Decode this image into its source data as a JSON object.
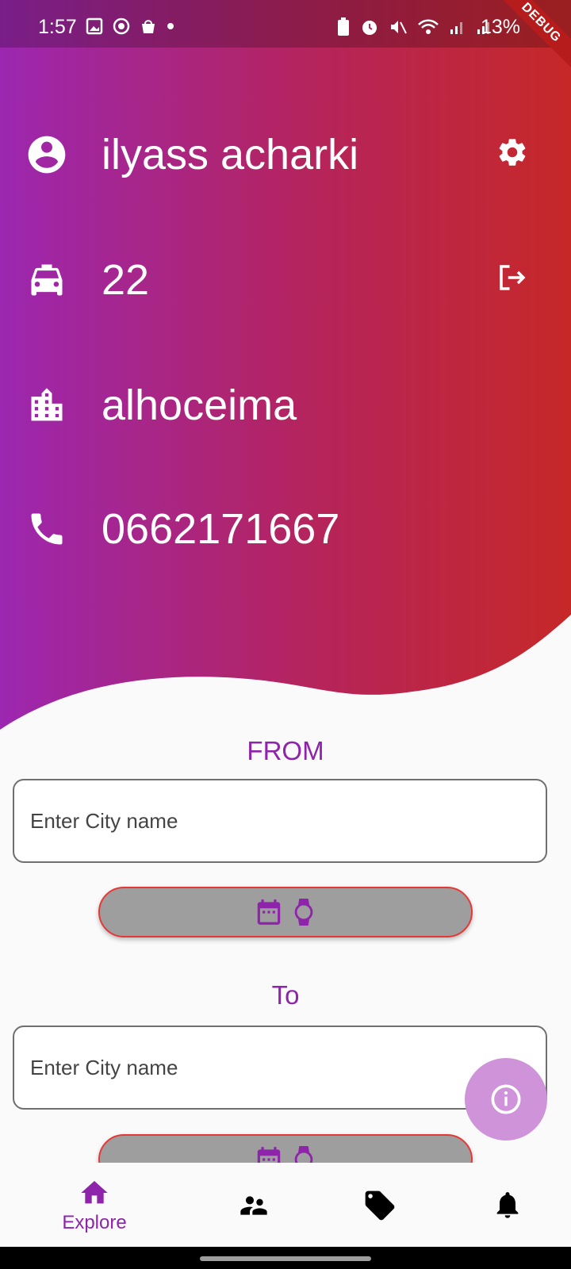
{
  "status_bar": {
    "time": "1:57",
    "battery": "13%",
    "debug_banner": "DEBUG"
  },
  "profile": {
    "name": "ilyass acharki",
    "taxi_number": "22",
    "city": "alhoceima",
    "phone": "0662171667",
    "icons": {
      "user": "account-circle-icon",
      "taxi": "taxi-icon",
      "city": "city-buildings-icon",
      "phone": "phone-icon",
      "settings": "gear-icon",
      "logout": "logout-icon"
    }
  },
  "from": {
    "label": "FROM",
    "placeholder": "Enter City name",
    "value": ""
  },
  "to": {
    "label": "To",
    "placeholder": "Enter City name",
    "value": ""
  },
  "fab": {
    "icon": "info-icon"
  },
  "bottom_nav": {
    "items": [
      {
        "label": "Explore",
        "icon": "home-icon",
        "active": true
      },
      {
        "label": "",
        "icon": "people-icon",
        "active": false
      },
      {
        "label": "",
        "icon": "tag-icon",
        "active": false
      },
      {
        "label": "",
        "icon": "bell-icon",
        "active": false
      }
    ]
  },
  "colors": {
    "gradient_start": "#9c27b0",
    "gradient_end": "#c62828",
    "accent": "#8e24aa",
    "pill_border": "#e53935",
    "pill_fill": "#9e9e9e",
    "fab": "#ce93d8"
  }
}
